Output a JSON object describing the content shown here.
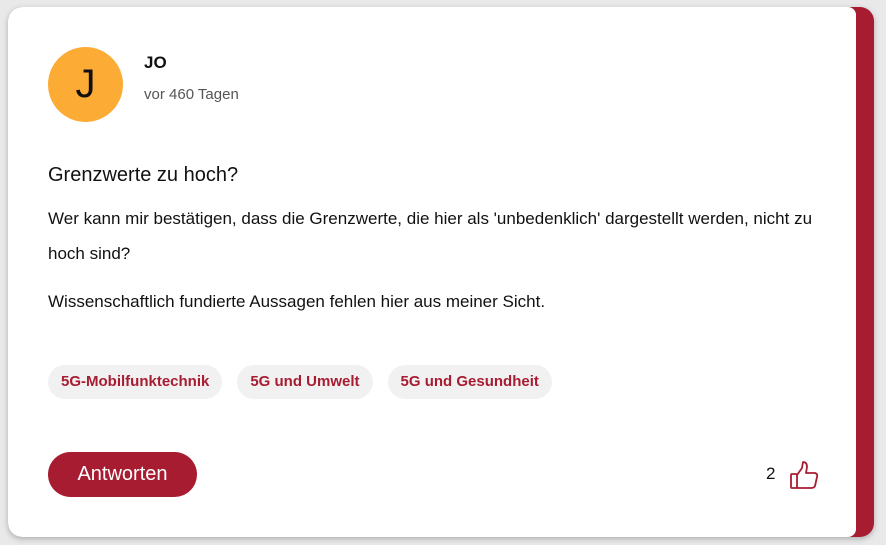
{
  "post": {
    "author_initial": "J",
    "author_name": "JO",
    "posted_ago": "vor 460 Tagen",
    "title": "Grenzwerte zu hoch?",
    "body_paragraph_1": "Wer kann mir bestätigen, dass die Grenzwerte, die hier als 'unbedenklich' dargestellt werden, nicht zu hoch sind?",
    "body_paragraph_2": "Wissenschaftlich fundierte Aussagen fehlen hier aus meiner Sicht.",
    "tags": [
      "5G-Mobilfunktechnik",
      "5G und Umwelt",
      "5G und Gesundheit"
    ],
    "reply_label": "Antworten",
    "like_count": "2",
    "like_icon": "thumbs-up-icon"
  },
  "colors": {
    "accent": "#a81c32",
    "avatar_bg": "#fcab35",
    "tag_bg": "#f1f1f1"
  }
}
